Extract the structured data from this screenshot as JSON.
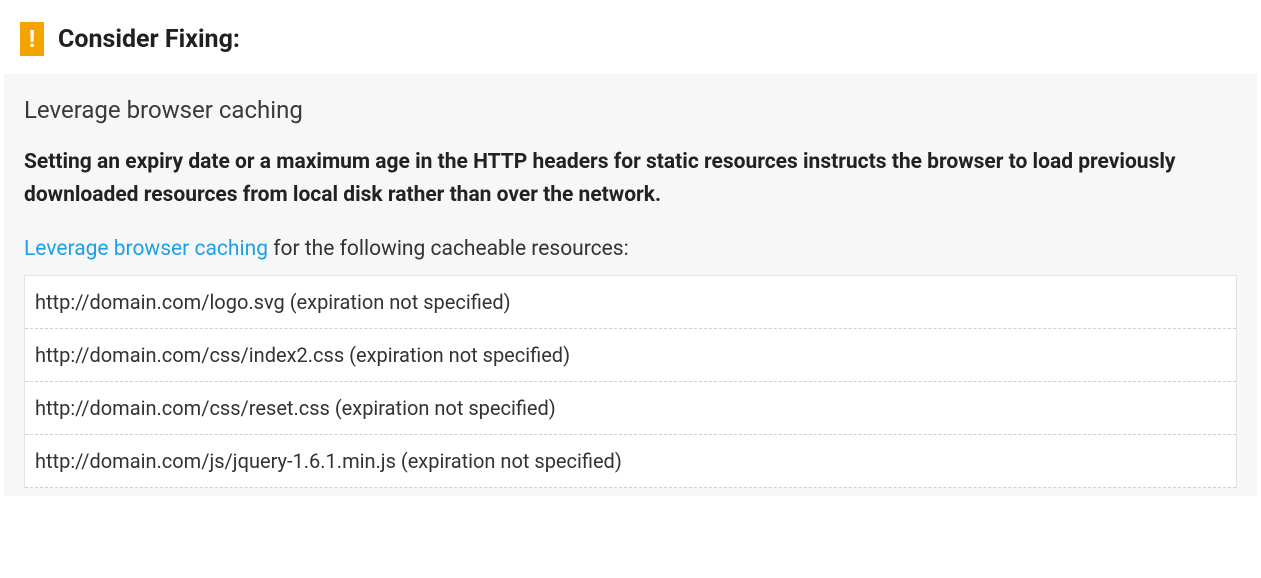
{
  "header": {
    "badge_symbol": "!",
    "title": "Consider Fixing:"
  },
  "panel": {
    "subtitle": "Leverage browser caching",
    "description": "Setting an expiry date or a maximum age in the HTTP headers for static resources instructs the browser to load previously downloaded resources from local disk rather than over the network.",
    "instruction_link_text": "Leverage browser caching",
    "instruction_rest": " for the following cacheable resources:",
    "resources": [
      "http://domain.com/logo.svg (expiration not specified)",
      "http://domain.com/css/index2.css (expiration not specified)",
      "http://domain.com/css/reset.css (expiration not specified)",
      "http://domain.com/js/jquery-1.6.1.min.js (expiration not specified)"
    ]
  },
  "colors": {
    "badge_bg": "#f5a300",
    "link": "#1ea0e6",
    "panel_bg": "#f7f7f7"
  }
}
